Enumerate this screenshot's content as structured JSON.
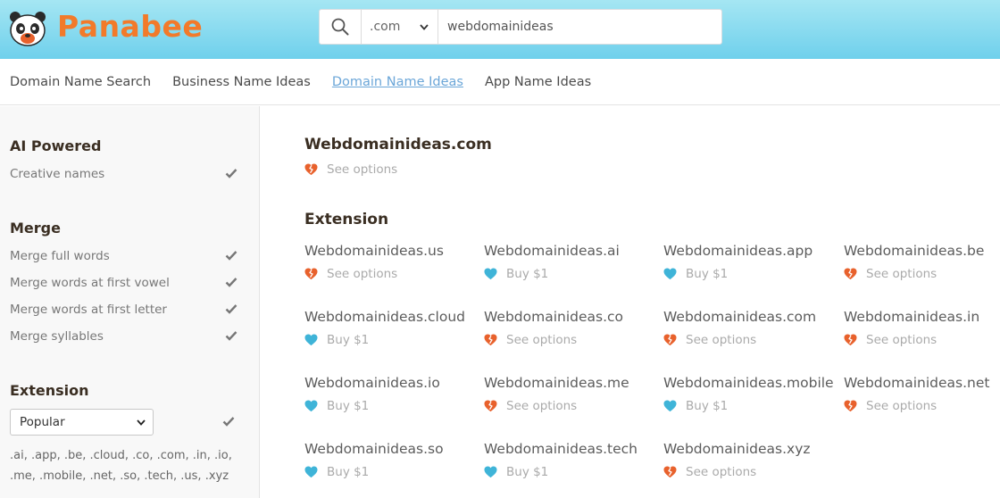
{
  "brand": {
    "name": "Panabee"
  },
  "search": {
    "tld": ".com",
    "query": "webdomainideas"
  },
  "nav": [
    {
      "label": "Domain Name Search",
      "active": false
    },
    {
      "label": "Business Name Ideas",
      "active": false
    },
    {
      "label": "Domain Name Ideas",
      "active": true
    },
    {
      "label": "App Name Ideas",
      "active": false
    }
  ],
  "sidebar": {
    "ai": {
      "heading": "AI Powered",
      "options": [
        "Creative names"
      ]
    },
    "merge": {
      "heading": "Merge",
      "options": [
        "Merge full words",
        "Merge words at first vowel",
        "Merge words at first letter",
        "Merge syllables"
      ]
    },
    "extension": {
      "heading": "Extension",
      "selected": "Popular",
      "list": ".ai, .app, .be, .cloud, .co, .com, .in, .io, .me, .mobile, .net, .so, .tech, .us, .xyz"
    }
  },
  "main": {
    "primary": {
      "name": "Webdomainideas.com",
      "status": "See options",
      "status_type": "taken"
    },
    "extension_heading": "Extension",
    "domains": [
      {
        "name": "Webdomainideas.us",
        "status": "See options",
        "status_type": "taken"
      },
      {
        "name": "Webdomainideas.ai",
        "status": "Buy $1",
        "status_type": "available"
      },
      {
        "name": "Webdomainideas.app",
        "status": "Buy $1",
        "status_type": "available"
      },
      {
        "name": "Webdomainideas.be",
        "status": "See options",
        "status_type": "taken"
      },
      {
        "name": "Webdomainideas.cloud",
        "status": "Buy $1",
        "status_type": "available"
      },
      {
        "name": "Webdomainideas.co",
        "status": "See options",
        "status_type": "taken"
      },
      {
        "name": "Webdomainideas.com",
        "status": "See options",
        "status_type": "taken"
      },
      {
        "name": "Webdomainideas.in",
        "status": "See options",
        "status_type": "taken"
      },
      {
        "name": "Webdomainideas.io",
        "status": "Buy $1",
        "status_type": "available"
      },
      {
        "name": "Webdomainideas.me",
        "status": "See options",
        "status_type": "taken"
      },
      {
        "name": "Webdomainideas.mobile",
        "status": "Buy $1",
        "status_type": "available"
      },
      {
        "name": "Webdomainideas.net",
        "status": "See options",
        "status_type": "taken"
      },
      {
        "name": "Webdomainideas.so",
        "status": "Buy $1",
        "status_type": "available"
      },
      {
        "name": "Webdomainideas.tech",
        "status": "Buy $1",
        "status_type": "available"
      },
      {
        "name": "Webdomainideas.xyz",
        "status": "See options",
        "status_type": "taken"
      }
    ]
  },
  "colors": {
    "header": "#6fd0ec",
    "brand": "#f27a2a",
    "taken_heart": "#e8612c",
    "available_heart": "#3fb4d8",
    "link_active": "#6ba6d8"
  }
}
